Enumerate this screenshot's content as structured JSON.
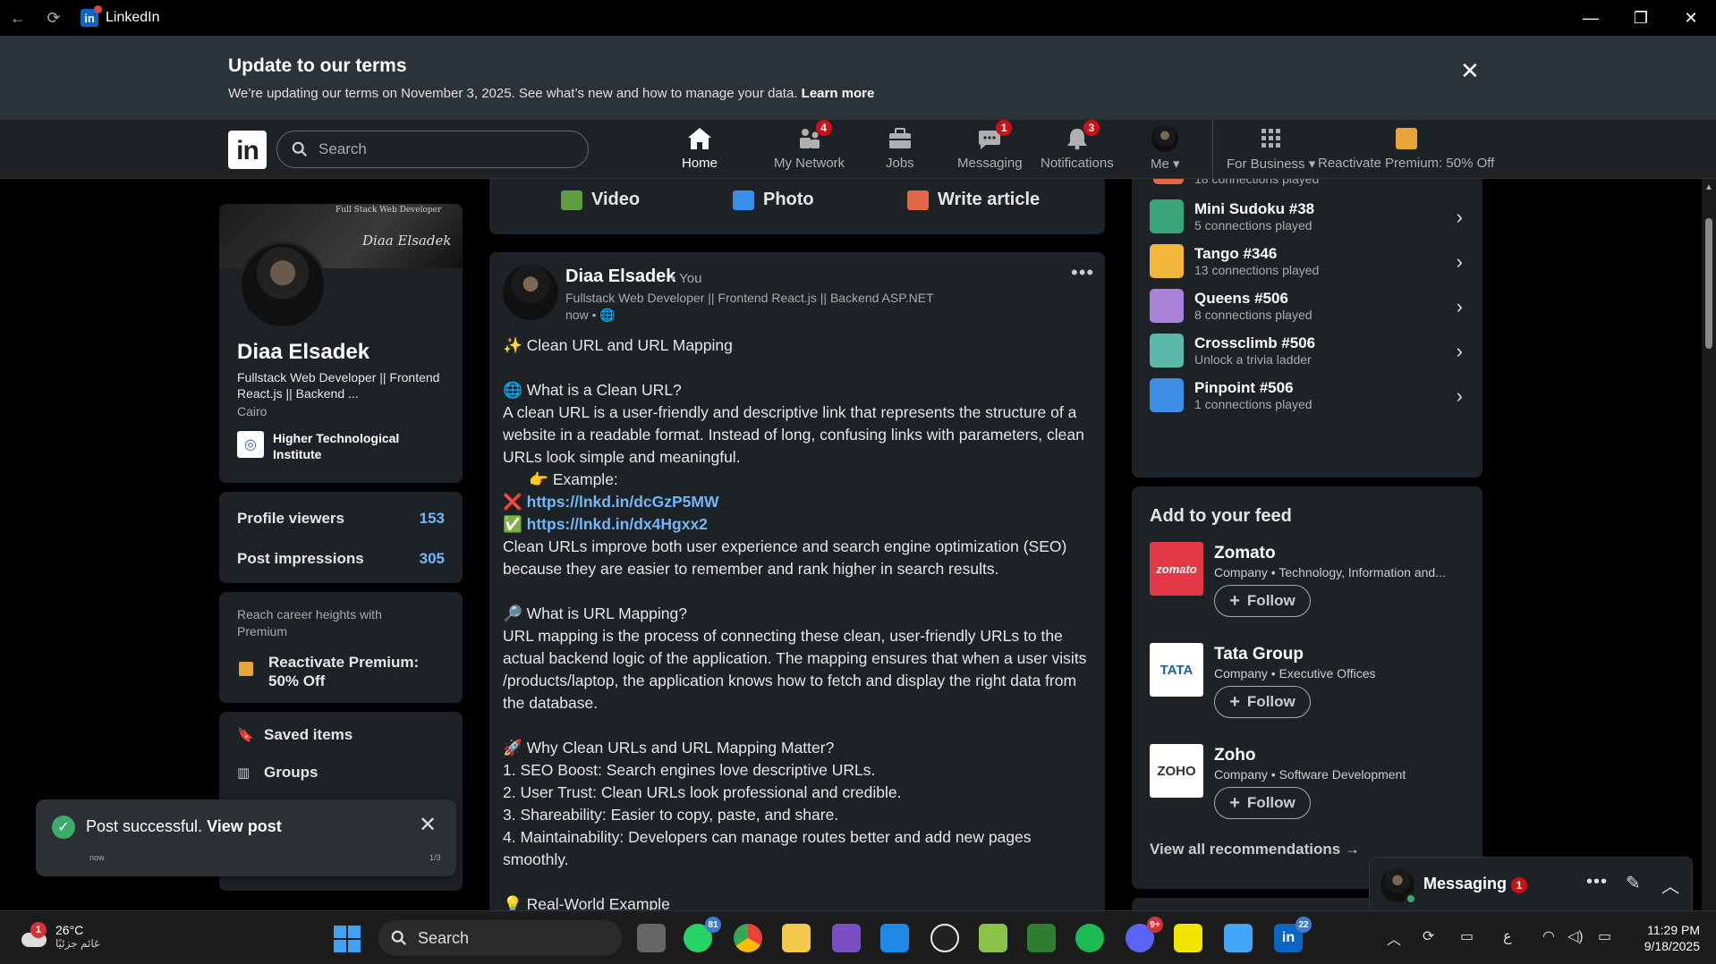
{
  "window": {
    "title": "LinkedIn"
  },
  "banner": {
    "title": "Update to our terms",
    "text": "We’re updating our terms on November 3, 2025. See what’s new and how to manage your data.",
    "link": "Learn more"
  },
  "nav": {
    "logo": "in",
    "search_placeholder": "Search",
    "items": [
      {
        "label": "Home"
      },
      {
        "label": "My Network",
        "badge": "4"
      },
      {
        "label": "Jobs"
      },
      {
        "label": "Messaging",
        "badge": "1"
      },
      {
        "label": "Notifications",
        "badge": "3"
      },
      {
        "label": "Me"
      },
      {
        "label": "For Business"
      },
      {
        "label": "Reactivate Premium: 50% Off"
      }
    ]
  },
  "profile": {
    "cover_text": "Diaa Elsadek",
    "cover_sub": "Full Stack Web Developer",
    "name": "Diaa Elsadek",
    "headline": "Fullstack Web Developer || Frontend React.js || Backend ...",
    "location": "Cairo",
    "school": "Higher Technological Institute"
  },
  "stats": {
    "viewers_label": "Profile viewers",
    "viewers": "153",
    "impressions_label": "Post impressions",
    "impressions": "305"
  },
  "premium": {
    "text": "Reach career heights with Premium",
    "link": "Reactivate Premium: 50% Off"
  },
  "side_links": {
    "saved": "Saved items",
    "groups": "Groups"
  },
  "toast": {
    "text": "Post successful.",
    "link": "View post",
    "time": "now",
    "count": "1/3"
  },
  "share": {
    "video": "Video",
    "photo": "Photo",
    "article": "Write article"
  },
  "post": {
    "author": "Diaa Elsadek",
    "you": "• You",
    "headline": "Fullstack Web Developer || Frontend React.js || Backend ASP.NET",
    "time": "now •",
    "lines": [
      "✨ Clean URL and URL Mapping",
      "",
      "🌐 What is a Clean URL?",
      "A clean URL is a user-friendly and descriptive link that represents the structure of a",
      "website in a readable format. Instead of long, confusing links with parameters, clean",
      "URLs look simple and meaningful.",
      "      👉 Example:",
      "❌ https://lnkd.in/dcGzP5MW",
      "✅ https://lnkd.in/dx4Hgxx2",
      "Clean URLs improve both user experience and search engine optimization (SEO)",
      "because they are easier to remember and rank higher in search results.",
      "",
      "🔎 What is URL Mapping?",
      "URL mapping is the process of connecting these clean, user-friendly URLs to the",
      "actual backend logic of the application. The mapping ensures that when a user visits",
      "/products/laptop, the application knows how to fetch and display the right data from",
      "the database.",
      "",
      "🚀 Why Clean URLs and URL Mapping Matter?",
      "1. SEO Boost: Search engines love descriptive URLs.",
      "2. User Trust: Clean URLs look professional and credible.",
      "3. Shareability: Easier to copy, paste, and share.",
      "4. Maintainability: Developers can manage routes better and add new pages",
      "smoothly.",
      "",
      "💡 Real-World Example"
    ]
  },
  "games": {
    "partial": "18 connections played",
    "items": [
      {
        "title": "Mini Sudoku #38",
        "sub": "5 connections played",
        "color": "#3aa57a"
      },
      {
        "title": "Tango #346",
        "sub": "13 connections played",
        "color": "#f5b73b"
      },
      {
        "title": "Queens #506",
        "sub": "8 connections played",
        "color": "#a882d6"
      },
      {
        "title": "Crossclimb #506",
        "sub": "Unlock a trivia ladder",
        "color": "#5ab9a8"
      },
      {
        "title": "Pinpoint #506",
        "sub": "1 connections played",
        "color": "#3e8ee6"
      }
    ]
  },
  "feed": {
    "title": "Add to your feed",
    "follow": "Follow",
    "companies": [
      {
        "name": "Zomato",
        "sub": "Company • Technology, Information and...",
        "logo": "zomato",
        "color": "#e23744"
      },
      {
        "name": "Tata Group",
        "sub": "Company • Executive Offices",
        "logo": "TATA",
        "color": "#ffffff"
      },
      {
        "name": "Zoho",
        "sub": "Company • Software Development",
        "logo": "ZOHO",
        "color": "#ffffff"
      }
    ],
    "view_all": "View all recommendations →"
  },
  "messaging": {
    "title": "Messaging",
    "badge": "1"
  },
  "taskbar": {
    "weather_temp": "26°C",
    "weather_desc": "غائم جزئيًا",
    "weather_badge": "1",
    "search": "Search",
    "badges": {
      "whatsapp": "81",
      "discord": "9+",
      "linkedin": "22"
    },
    "lang": "ع",
    "time": "11:29 PM",
    "date": "9/18/2025"
  }
}
